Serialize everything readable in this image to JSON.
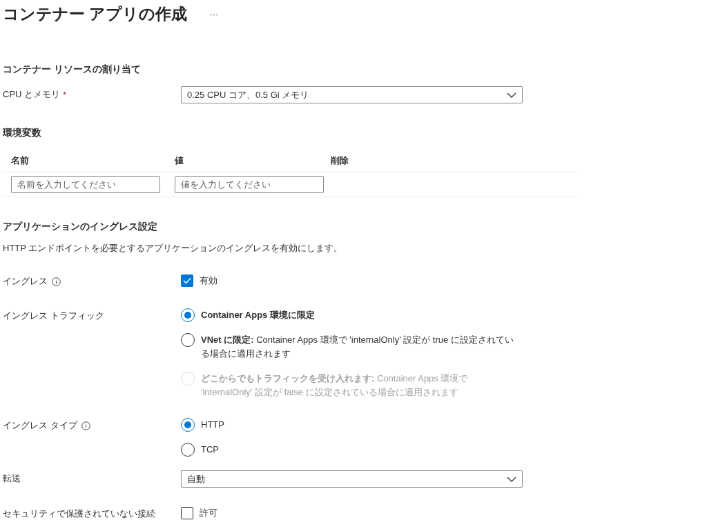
{
  "header": {
    "title": "コンテナー アプリの作成",
    "more": "···"
  },
  "resources": {
    "heading": "コンテナー リソースの割り当て",
    "cpu": {
      "label": "CPU とメモリ",
      "required_mark": "*",
      "value": "0.25 CPU コア、0.5 Gi メモリ"
    }
  },
  "environment_variables": {
    "heading": "環境変数",
    "columns": [
      "名前",
      "値",
      "削除"
    ],
    "inputs": [
      {
        "placeholder": "名前を入力してください"
      },
      {
        "placeholder": "値を入力してください"
      }
    ]
  },
  "ingress": {
    "heading": "アプリケーションのイングレス設定",
    "description": "HTTP エンドポイントを必要とするアプリケーションのイングレスを有効にします。",
    "fields": [
      {
        "kind": "checkbox",
        "label": "イングレス",
        "info": true,
        "option": "有効",
        "checked": true
      },
      {
        "kind": "radio",
        "label": "イングレス トラフィック",
        "info": false,
        "options": [
          {
            "text": "**Container Apps 環境に限定**",
            "selected": true,
            "disabled": false
          },
          {
            "text": "**VNet に限定:** Container Apps 環境で 'internalOnly' 設定が true に設定されている場合に適用されます",
            "selected": false,
            "disabled": false
          },
          {
            "text": "**どこからでもトラフィックを受け入れます:** Container Apps 環境で 'internalOnly' 設定が false に設定されている場合に適用されます",
            "selected": false,
            "disabled": true
          }
        ]
      },
      {
        "kind": "radio",
        "label": "イングレス タイプ",
        "info": true,
        "options": [
          {
            "text": "HTTP",
            "selected": true,
            "disabled": false
          },
          {
            "text": "TCP",
            "selected": false,
            "disabled": false
          }
        ]
      },
      {
        "kind": "dropdown",
        "label": "転送",
        "info": false,
        "value": "自動"
      },
      {
        "kind": "checkbox",
        "label": "セキュリティで保護されていない接続",
        "info": false,
        "option": "許可",
        "checked": false
      }
    ]
  }
}
